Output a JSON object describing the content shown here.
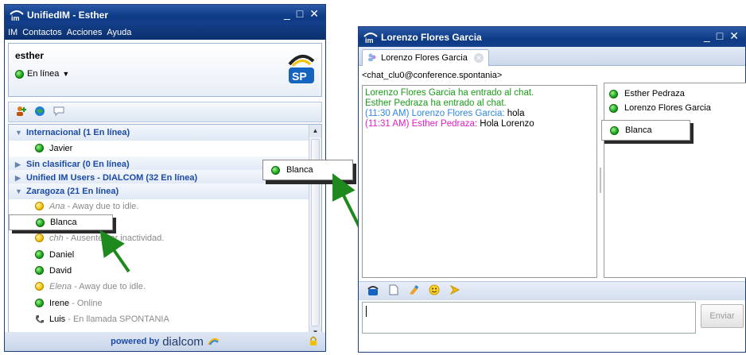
{
  "main_window": {
    "title": "UnifiedIM - Esther",
    "menu": [
      "IM",
      "Contactos",
      "Acciones",
      "Ayuda"
    ],
    "user": {
      "name": "esther",
      "status": "En línea"
    },
    "groups": [
      {
        "label": "Internacional (1 En línea)",
        "expanded": true
      },
      {
        "label": "Sin clasificar (0 En línea)",
        "expanded": false
      },
      {
        "label": "Unified IM Users - DIALCOM (32 En línea)",
        "expanded": false
      },
      {
        "label": "Zaragoza (21 En línea)",
        "expanded": true
      }
    ],
    "contacts": [
      {
        "name": "Javier",
        "status": "",
        "presence": "online"
      },
      {
        "name": "Ana",
        "status": " - Away due to idle.",
        "presence": "away"
      },
      {
        "name": "Blanca",
        "status": "",
        "presence": "online"
      },
      {
        "name": "chh",
        "status": " - Ausente por inactividad.",
        "presence": "away"
      },
      {
        "name": "Daniel",
        "status": "",
        "presence": "online"
      },
      {
        "name": "David",
        "status": "",
        "presence": "online"
      },
      {
        "name": "Elena",
        "status": " - Away due to idle.",
        "presence": "away"
      },
      {
        "name": "Irene",
        "status": " - Online",
        "presence": "online"
      },
      {
        "name": "Luis",
        "status": " - En llamada SPONTANIA",
        "presence": "phone"
      }
    ],
    "footer": {
      "powered": "powered by",
      "brand": "dialcom"
    }
  },
  "drag_callout": {
    "label": "Blanca"
  },
  "chat_window": {
    "title": "Lorenzo Flores Garcia",
    "tab_label": "Lorenzo Flores Garcia",
    "room": "<chat_clu0@conference.spontania>",
    "messages": {
      "m1": "Lorenzo Flores Garcia ha entrado al chat.",
      "m2": "Esther Pedraza ha entrado al chat.",
      "m3_prefix": "(11:30 AM) Lorenzo Flores Garcia:",
      "m3_text": " hola",
      "m4_prefix": "(11:31 AM) Esther Pedraza:",
      "m4_text": " Hola Lorenzo"
    },
    "participants": [
      "Esther Pedraza",
      "Lorenzo Flores Garcia",
      "Blanca"
    ],
    "send_label": "Enviar"
  },
  "colors": {
    "titlebar": "#0d3a85",
    "group_text": "#1b4aa5",
    "system_msg": "#1a9a1a",
    "user_a": "#2f86e0",
    "user_b": "#e01cc6",
    "arrow": "#1e8a1e"
  }
}
